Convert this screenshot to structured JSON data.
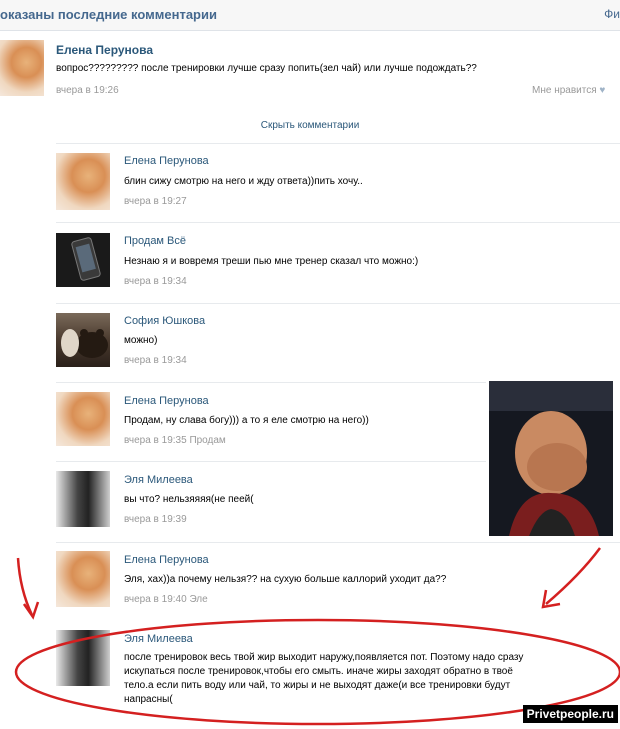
{
  "header": {
    "title": "оказаны последние комментарии",
    "right": "Фи"
  },
  "post": {
    "author": "Елена Перунова",
    "text": "вопрос????????? после тренировки лучше сразу попить(зел чай) или лучше подождать??",
    "time": "вчера в 19:26",
    "like": "Мне нравится"
  },
  "hide_comments": "Скрыть комментарии",
  "comments": [
    {
      "author": "Елена Перунова",
      "text": "блин сижу смотрю на него и жду ответа))пить хочу..",
      "time": "вчера в 19:27",
      "reply_to": ""
    },
    {
      "author": "Продам Всё",
      "text": "Незнаю я и вовремя треши пью мне тренер сказал что можно:)",
      "time": "вчера в 19:34",
      "reply_to": ""
    },
    {
      "author": "София Юшкова",
      "text": "можно)",
      "time": "вчера в 19:34",
      "reply_to": ""
    },
    {
      "author": "Елена Перунова",
      "text": "Продам, ну слава богу))) а то я еле смотрю на него))",
      "time": "вчера в 19:35",
      "reply_to": "Продам"
    },
    {
      "author": "Эля Милеева",
      "text": "вы что? нельзяяяя(не пеей(",
      "time": "вчера в 19:39",
      "reply_to": ""
    },
    {
      "author": "Елена Перунова",
      "text": "Эля, хах))а почему нельзя?? на сухую больше каллорий уходит да??",
      "time": "вчера в 19:40",
      "reply_to": "Эле"
    },
    {
      "author": "Эля Милеева",
      "text_lines": [
        "после тренировок весь твой жир выходит наружу,появляется пот. Поэтому надо сразу",
        "искупаться после тренировок,чтобы его смыть. иначе жиры заходят обратно в твоё",
        "тело.а если пить воду или чай, то жиры и не выходят даже(и все тренировки будут",
        "напрасны("
      ]
    }
  ],
  "watermark": "Privetpeople.ru",
  "colors": {
    "link": "#2b587a",
    "meta": "#999999",
    "annotation": "#d42020"
  }
}
